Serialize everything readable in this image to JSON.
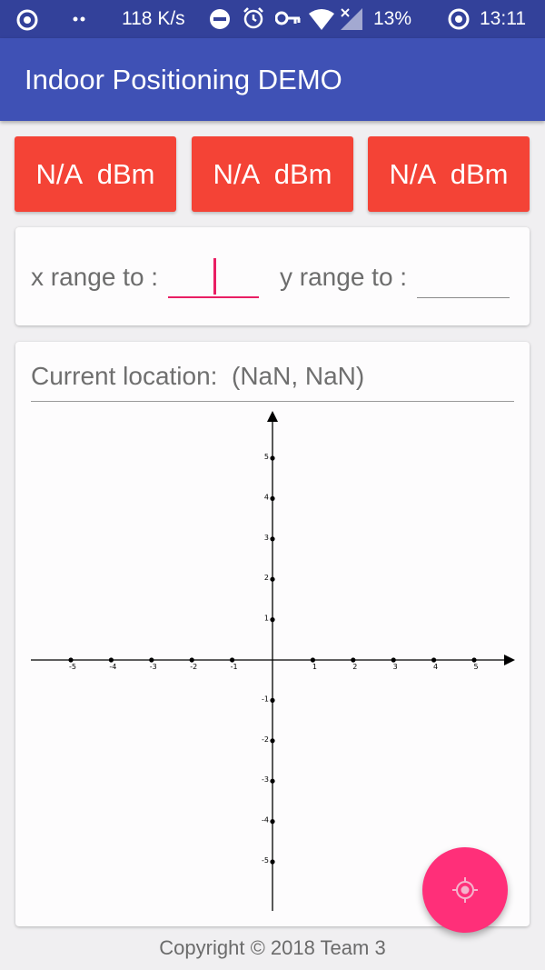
{
  "status_bar": {
    "speed": "118 K/s",
    "battery": "13%",
    "time": "13:11"
  },
  "app_bar": {
    "title": "Indoor Positioning DEMO"
  },
  "rssi_buttons": [
    {
      "label": "N/A  dBm"
    },
    {
      "label": "N/A  dBm"
    },
    {
      "label": "N/A  dBm"
    }
  ],
  "range": {
    "x_label": "x range to :",
    "x_value": "",
    "y_label": "y range to :",
    "y_value": ""
  },
  "location": {
    "label": "Current location:  (NaN, NaN)"
  },
  "chart_data": {
    "type": "scatter",
    "x_ticks": [
      -5,
      -4,
      -3,
      -2,
      -1,
      1,
      2,
      3,
      4,
      5
    ],
    "y_ticks": [
      -5,
      -4,
      -3,
      -2,
      -1,
      1,
      2,
      3,
      4,
      5
    ],
    "xlim": [
      -6,
      6
    ],
    "ylim": [
      -6,
      6
    ],
    "points": [],
    "grid": false
  },
  "fab": {
    "icon": "locate-target-icon"
  },
  "footer": {
    "text": "Copyright © 2018 Team 3"
  }
}
